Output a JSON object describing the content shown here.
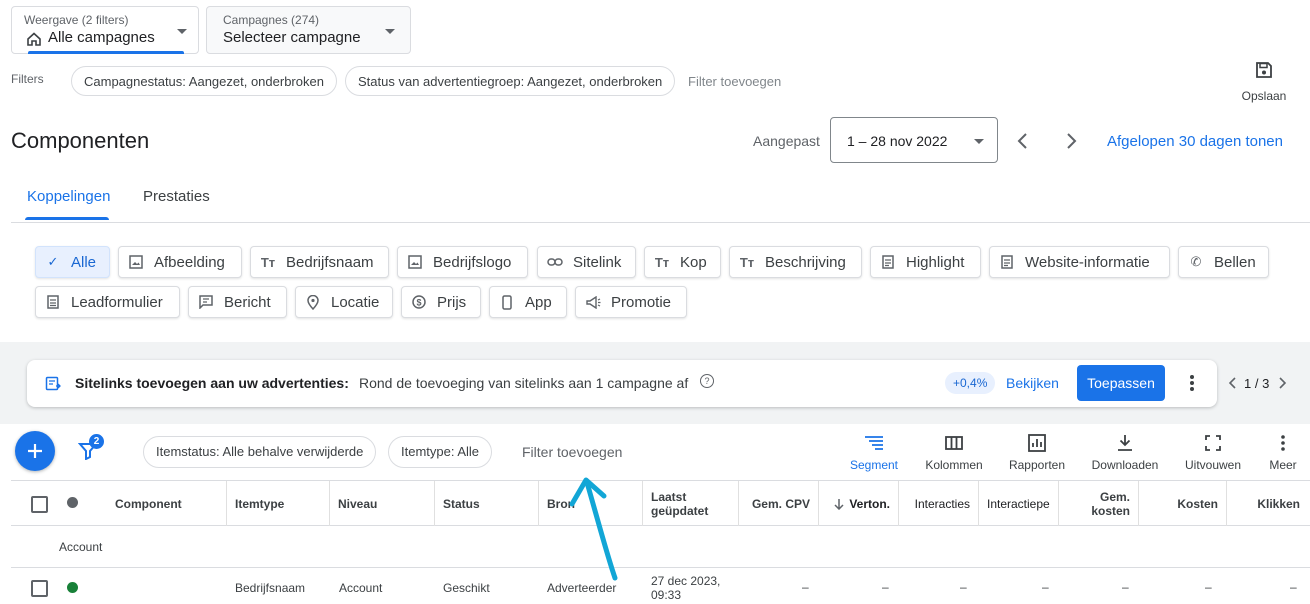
{
  "view_selector": {
    "caption": "Weergave (2 filters)",
    "value": "Alle campagnes"
  },
  "campaign_selector": {
    "caption": "Campagnes (274)",
    "value": "Selecteer campagne"
  },
  "filters": {
    "label": "Filters",
    "chips": [
      "Campagnestatus: Aangezet, onderbroken",
      "Status van advertentiegroep: Aangezet, onderbroken"
    ],
    "add_label": "Filter toevoegen"
  },
  "save": {
    "label": "Opslaan"
  },
  "page_title": "Componenten",
  "date": {
    "prefix": "Aangepast",
    "range": "1 – 28 nov 2022",
    "show_last_30": "Afgelopen 30 dagen tonen"
  },
  "tabs": [
    {
      "label": "Koppelingen",
      "active": true
    },
    {
      "label": "Prestaties",
      "active": false
    }
  ],
  "asset_types": [
    {
      "label": "Alle",
      "icon": "check-icon",
      "selected": true
    },
    {
      "label": "Afbeelding",
      "icon": "image-icon"
    },
    {
      "label": "Bedrijfsnaam",
      "icon": "text-icon"
    },
    {
      "label": "Bedrijfslogo",
      "icon": "image-icon"
    },
    {
      "label": "Sitelink",
      "icon": "link-icon"
    },
    {
      "label": "Kop",
      "icon": "text-icon"
    },
    {
      "label": "Beschrijving",
      "icon": "text-icon"
    },
    {
      "label": "Highlight",
      "icon": "document-icon"
    },
    {
      "label": "Website-informatie",
      "icon": "document-icon"
    },
    {
      "label": "Bellen",
      "icon": "phone-icon"
    },
    {
      "label": "Leadformulier",
      "icon": "form-icon"
    },
    {
      "label": "Bericht",
      "icon": "message-icon"
    },
    {
      "label": "Locatie",
      "icon": "location-icon"
    },
    {
      "label": "Prijs",
      "icon": "price-icon"
    },
    {
      "label": "App",
      "icon": "app-icon"
    },
    {
      "label": "Promotie",
      "icon": "promotion-icon"
    }
  ],
  "recommendation": {
    "title": "Sitelinks toevoegen aan uw advertenties:",
    "text": "Rond de toevoeging van sitelinks aan 1 campagne af",
    "uplift": "+0,4%",
    "view": "Bekijken",
    "apply": "Toepassen",
    "pager": "1 / 3"
  },
  "toolbar": {
    "filter_count": "2",
    "chips": [
      "Itemstatus: Alle behalve verwijderde",
      "Itemtype: Alle"
    ],
    "add_filter": "Filter toevoegen",
    "tools": [
      {
        "label": "Segment",
        "icon": "segment-icon",
        "active": true
      },
      {
        "label": "Kolommen",
        "icon": "columns-icon"
      },
      {
        "label": "Rapporten",
        "icon": "reports-icon"
      },
      {
        "label": "Downloaden",
        "icon": "download-icon"
      },
      {
        "label": "Uitvouwen",
        "icon": "expand-icon"
      },
      {
        "label": "Meer",
        "icon": "more-vert-icon"
      }
    ]
  },
  "table": {
    "columns": [
      "Component",
      "Itemtype",
      "Niveau",
      "Status",
      "Bron",
      "Laatst geüpdatet",
      "Gem. CPV",
      "Verton.",
      "Interacties",
      "Interactiepe",
      "Gem. kosten",
      "Kosten",
      "Klikken"
    ],
    "group_label": "Account",
    "rows": [
      {
        "status_color": "#188038",
        "cells": [
          "",
          "Bedrijfsnaam",
          "Account",
          "Geschikt",
          "Adverteerder",
          "27 dec 2023, 09:33",
          "–",
          "–",
          "–",
          "–",
          "–",
          "–",
          "–"
        ]
      }
    ]
  },
  "colors": {
    "accent": "#1a73e8",
    "status_ok": "#188038",
    "annotation": "#12a6d6"
  }
}
